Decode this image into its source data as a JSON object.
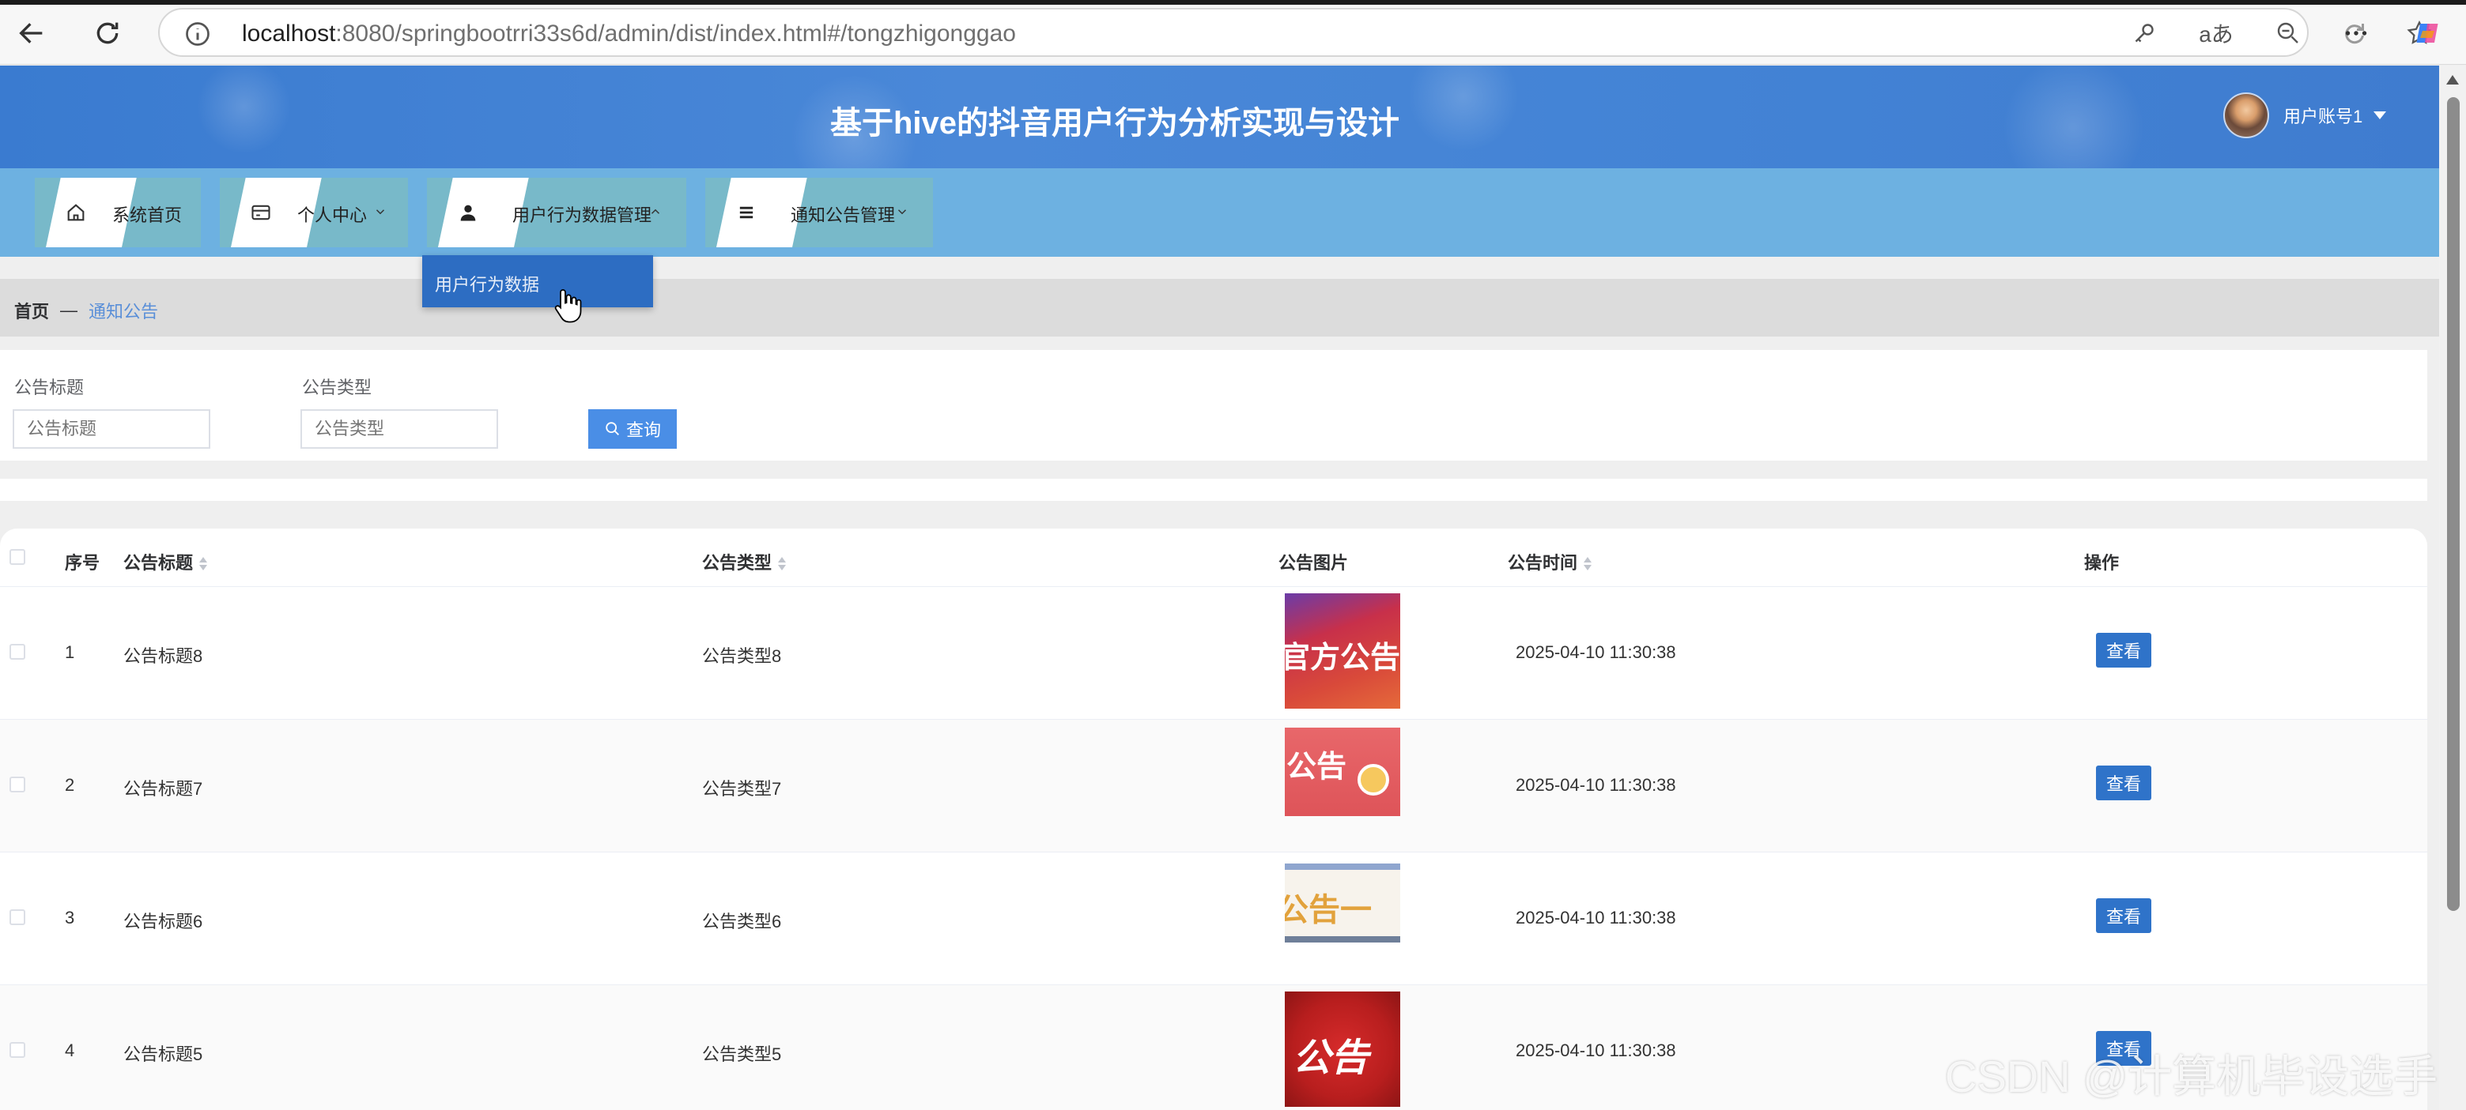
{
  "browser": {
    "url_host": "localhost",
    "url_rest": ":8080/springbootrri33s6d/admin/dist/index.html#/tongzhigonggao",
    "translate_label": "aあ"
  },
  "header": {
    "title": "基于hive的抖音用户行为分析实现与设计",
    "user_label": "用户账号1"
  },
  "nav": {
    "items": [
      {
        "label": "系统首页",
        "icon": "home-icon"
      },
      {
        "label": "个人中心",
        "icon": "card-icon"
      },
      {
        "label": "用户行为数据管理",
        "icon": "user-icon"
      },
      {
        "label": "通知公告管理",
        "icon": "list-icon"
      }
    ],
    "dropdown_item": "用户行为数据"
  },
  "breadcrumb": {
    "home": "首页",
    "separator": "—",
    "current": "通知公告"
  },
  "search": {
    "title_label": "公告标题",
    "title_placeholder": "公告标题",
    "type_label": "公告类型",
    "type_placeholder": "公告类型",
    "query_button": "查询"
  },
  "table": {
    "columns": {
      "index": "序号",
      "title": "公告标题",
      "type": "公告类型",
      "image": "公告图片",
      "time": "公告时间",
      "action": "操作"
    },
    "rows": [
      {
        "index": "1",
        "title": "公告标题8",
        "type": "公告类型8",
        "image_text": "官方公告",
        "time": "2025-04-10 11:30:38",
        "action": "查看"
      },
      {
        "index": "2",
        "title": "公告标题7",
        "type": "公告类型7",
        "image_text": "公告",
        "time": "2025-04-10 11:30:38",
        "action": "查看"
      },
      {
        "index": "3",
        "title": "公告标题6",
        "type": "公告类型6",
        "image_text": "公告一",
        "time": "2025-04-10 11:30:38",
        "action": "查看"
      },
      {
        "index": "4",
        "title": "公告标题5",
        "type": "公告类型5",
        "image_text": "公告",
        "time": "2025-04-10 11:30:38",
        "action": "查看"
      }
    ]
  },
  "watermark": "CSDN @计算机毕设选手",
  "colors": {
    "header_blue": "#3f7ccf",
    "nav_blue": "#6db1e1",
    "button_blue": "#2f73c9",
    "dropdown_blue": "#2d6dc2",
    "link_blue": "#5a8fd8"
  }
}
